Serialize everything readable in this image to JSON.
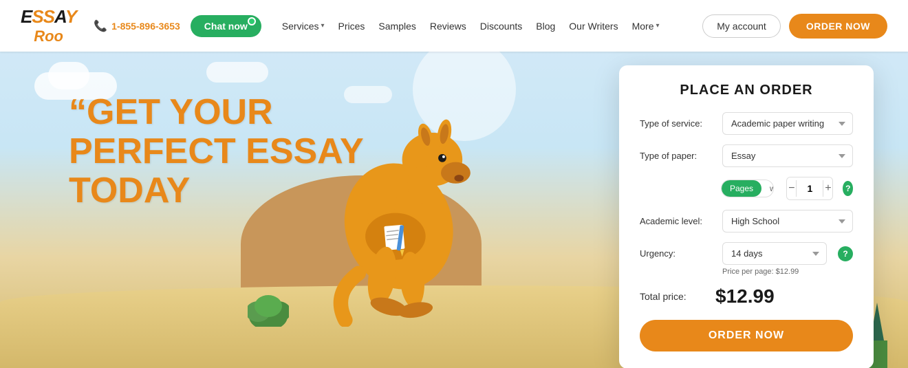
{
  "header": {
    "logo_text": "ESSAY",
    "logo_sub": "Roo",
    "phone": "1-855-896-3653",
    "chat_label": "Chat now",
    "nav": [
      {
        "label": "Services",
        "dropdown": true
      },
      {
        "label": "Prices",
        "dropdown": false
      },
      {
        "label": "Samples",
        "dropdown": false
      },
      {
        "label": "Reviews",
        "dropdown": false
      },
      {
        "label": "Discounts",
        "dropdown": false
      },
      {
        "label": "Blog",
        "dropdown": false
      },
      {
        "label": "Our Writers",
        "dropdown": false
      },
      {
        "label": "More",
        "dropdown": true
      }
    ],
    "my_account_label": "My account",
    "order_now_label": "ORDER NOW"
  },
  "hero": {
    "headline_quote": "“",
    "headline_line1": "GET YOUR",
    "headline_line2": "PERFECT ESSAY",
    "headline_line3": "TODAY"
  },
  "order_form": {
    "title": "PLACE AN ORDER",
    "service_label": "Type of service:",
    "service_value": "Academic paper writing",
    "paper_label": "Type of paper:",
    "paper_value": "Essay",
    "pages_label": "Pages",
    "words_label": "words",
    "qty_value": "1",
    "academic_label": "Academic level:",
    "academic_value": "High School",
    "urgency_label": "Urgency:",
    "urgency_value": "14 days",
    "price_per_page": "Price per page: $12.99",
    "total_label": "Total price:",
    "total_price": "$12.99",
    "order_btn_label": "ORDER NOW",
    "help_icon": "?",
    "minus_icon": "−",
    "plus_icon": "+"
  }
}
